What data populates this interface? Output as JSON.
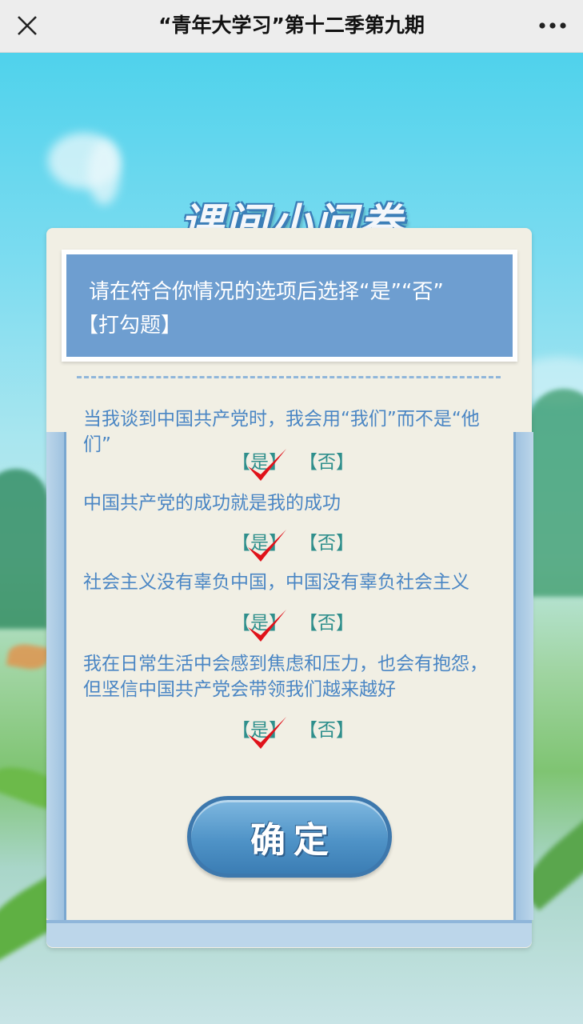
{
  "header": {
    "title": "“青年大学习”第十二季第九期",
    "close_icon": "close-icon",
    "more_icon": "more-dots-icon"
  },
  "survey": {
    "heading": "课间小问卷",
    "instruction_line1": "请在符合你情况的选项后选择“是”“否”",
    "instruction_line2": "【打勾题】",
    "yes_label": "【是】",
    "no_label": "【否】",
    "questions": [
      {
        "text": "当我谈到中国共产党时，我会用“我们”而不是“他们”",
        "selected": "yes"
      },
      {
        "text": "中国共产党的成功就是我的成功",
        "selected": "yes"
      },
      {
        "text": "社会主义没有辜负中国，中国没有辜负社会主义",
        "selected": "yes"
      },
      {
        "text": "我在日常生活中会感到焦虑和压力，也会有抱怨，但坚信中国共产党会带领我们越来越好",
        "selected": "yes"
      }
    ],
    "confirm_label": "确定"
  },
  "colors": {
    "accent": "#4a86c4",
    "instruction_bg": "#6e9ed0",
    "card_bg": "#f1efe4",
    "check": "#e0121a",
    "option_text": "#2f8f8c"
  }
}
